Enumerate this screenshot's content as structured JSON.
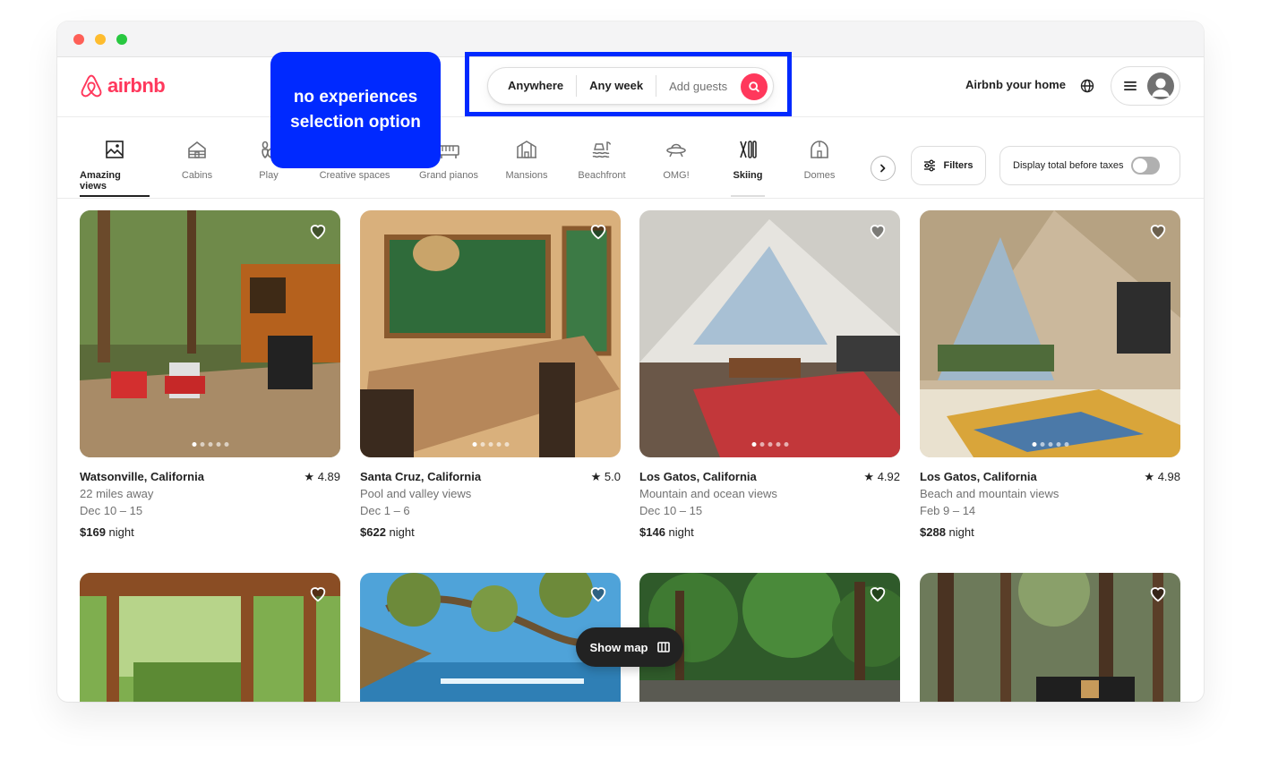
{
  "annotation": {
    "text": "no experiences selection option"
  },
  "brand": {
    "name": "airbnb",
    "color": "#ff385c"
  },
  "search": {
    "where": "Anywhere",
    "when": "Any week",
    "guests_placeholder": "Add guests"
  },
  "header_right": {
    "host_link": "Airbnb your home"
  },
  "categories": [
    {
      "label": "Amazing views",
      "icon": "mountain-view-icon",
      "active": true
    },
    {
      "label": "Cabins",
      "icon": "cabin-icon"
    },
    {
      "label": "Play",
      "icon": "bowling-icon"
    },
    {
      "label": "Creative spaces",
      "icon": "palette-icon"
    },
    {
      "label": "Grand pianos",
      "icon": "piano-icon"
    },
    {
      "label": "Mansions",
      "icon": "mansion-icon"
    },
    {
      "label": "Beachfront",
      "icon": "beach-icon"
    },
    {
      "label": "OMG!",
      "icon": "ufo-icon"
    },
    {
      "label": "Skiing",
      "icon": "skiing-icon"
    },
    {
      "label": "Domes",
      "icon": "dome-icon"
    }
  ],
  "toolbar": {
    "filters_label": "Filters",
    "tax_toggle_label": "Display total before taxes"
  },
  "listings": [
    {
      "location": "Watsonville, California",
      "rating": "4.89",
      "subtitle": "22 miles away",
      "dates": "Dec 10 – 15",
      "price": "$169",
      "price_unit": "night"
    },
    {
      "location": "Santa Cruz, California",
      "rating": "5.0",
      "subtitle": "Pool and valley views",
      "dates": "Dec 1 – 6",
      "price": "$622",
      "price_unit": "night"
    },
    {
      "location": "Los Gatos, California",
      "rating": "4.92",
      "subtitle": "Mountain and ocean views",
      "dates": "Dec 10 – 15",
      "price": "$146",
      "price_unit": "night"
    },
    {
      "location": "Los Gatos, California",
      "rating": "4.98",
      "subtitle": "Beach and mountain views",
      "dates": "Feb 9 – 14",
      "price": "$288",
      "price_unit": "night"
    }
  ],
  "show_map": {
    "label": "Show map"
  }
}
